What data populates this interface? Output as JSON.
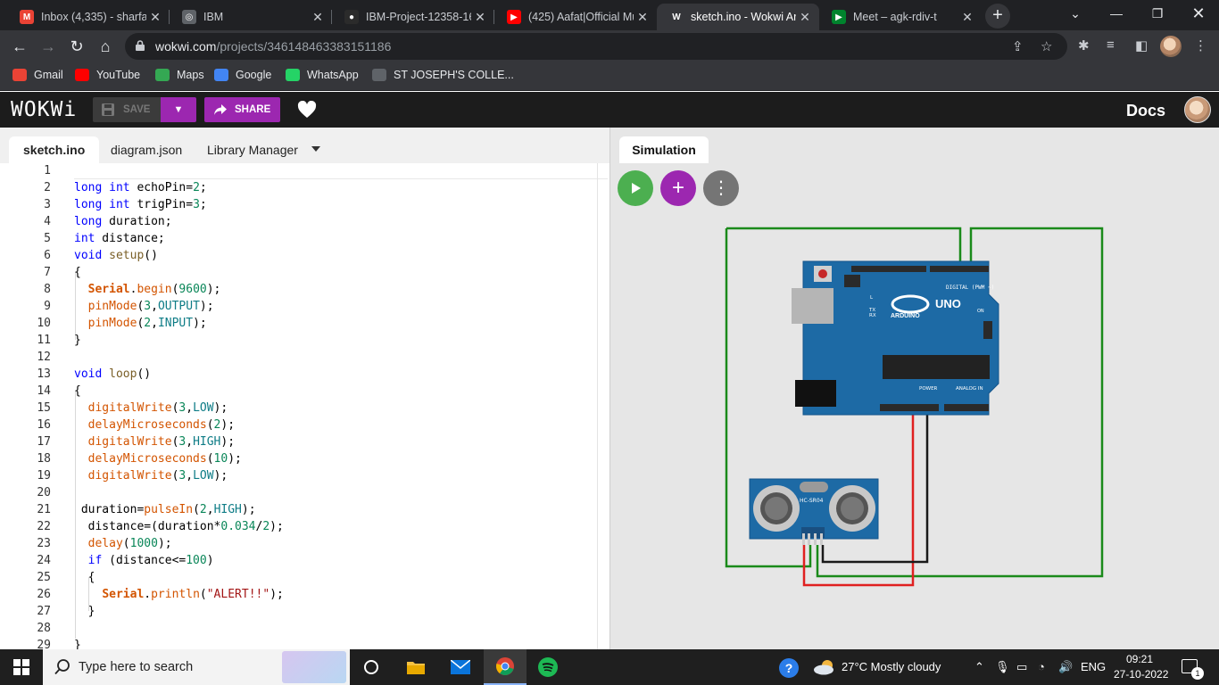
{
  "browser": {
    "tabs": [
      {
        "title": "Inbox (4,335) - sharfar",
        "icon": "gmail-icon",
        "color": "#ea4335",
        "glyph": "M"
      },
      {
        "title": "IBM",
        "icon": "globe-icon",
        "color": "#5f6368",
        "glyph": "◎"
      },
      {
        "title": "IBM-Project-12358-16",
        "icon": "github-icon",
        "color": "#2b2b2b",
        "glyph": "●"
      },
      {
        "title": "(425) Aafat|Official Mu",
        "icon": "youtube-icon",
        "color": "#ff0000",
        "glyph": "▶"
      },
      {
        "title": "sketch.ino - Wokwi Ar",
        "icon": "wokwi-icon",
        "color": "#35363a",
        "glyph": "W"
      },
      {
        "title": "Meet – agk-rdiv-t",
        "icon": "meet-icon",
        "color": "#00832d",
        "glyph": "▶"
      }
    ],
    "active_tab": 4,
    "url_host": "wokwi.com",
    "url_path": "/projects/346148463383151186",
    "bookmarks": [
      {
        "label": "Gmail",
        "icon": "gmail-icon",
        "color": "#ea4335"
      },
      {
        "label": "YouTube",
        "icon": "youtube-icon",
        "color": "#ff0000"
      },
      {
        "label": "Maps",
        "icon": "maps-icon",
        "color": "#34a853"
      },
      {
        "label": "Google",
        "icon": "google-icon",
        "color": "#4285f4"
      },
      {
        "label": "WhatsApp",
        "icon": "whatsapp-icon",
        "color": "#25d366"
      },
      {
        "label": "ST JOSEPH'S COLLE...",
        "icon": "globe-icon",
        "color": "#5f6368"
      }
    ]
  },
  "wokwi": {
    "logo": "WOKWi",
    "save_label": "SAVE",
    "share_label": "SHARE",
    "docs_label": "Docs",
    "editor_tabs": [
      "sketch.ino",
      "diagram.json",
      "Library Manager"
    ],
    "active_editor_tab": 0,
    "simulation_tab": "Simulation",
    "colors": {
      "accent": "#9c27b0",
      "play": "#4caf50",
      "menu": "#757575"
    }
  },
  "code_lines": [
    "",
    "long int echoPin=2;",
    "long int trigPin=3;",
    "long duration;",
    "int distance;",
    "void setup()",
    "{",
    "  Serial.begin(9600);",
    "  pinMode(3,OUTPUT);",
    "  pinMode(2,INPUT);",
    "}",
    "",
    "void loop()",
    "{",
    "  digitalWrite(3,LOW);",
    "  delayMicroseconds(2);",
    "  digitalWrite(3,HIGH);",
    "  delayMicroseconds(10);",
    "  digitalWrite(3,LOW);",
    "",
    " duration=pulseIn(2,HIGH);",
    "  distance=(duration*0.034/2);",
    "  delay(1000);",
    "  if (distance<=100)",
    "  {",
    "    Serial.println(\"ALERT!!\");",
    "  }",
    "",
    "}"
  ],
  "circuit": {
    "board_label": "UNO",
    "board_brand": "ARDUINO",
    "board_digital": "DIGITAL (PWM ~)",
    "board_power": "POWER",
    "board_analog": "ANALOG IN",
    "board_tx": "TX",
    "board_rx": "RX",
    "board_l": "L",
    "board_on": "ON",
    "sensor_label": "HC-SR04",
    "board_color": "#1d6aa5",
    "wire_colors": {
      "green": "#1a8a1a",
      "red": "#e02020",
      "black": "#1a1a1a"
    }
  },
  "taskbar": {
    "search_placeholder": "Type here to search",
    "weather": "27°C  Mostly cloudy",
    "language": "ENG",
    "time": "09:21",
    "date": "27-10-2022",
    "notifications": "1"
  }
}
